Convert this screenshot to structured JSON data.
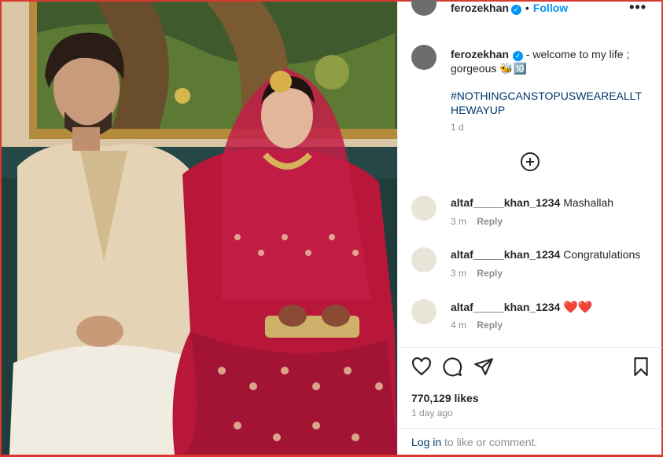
{
  "post": {
    "author": "ferozekhan",
    "verified_mark": "✓",
    "separator": "•",
    "follow_label": "Follow",
    "more_label": "•••",
    "caption_text": "- welcome to my life ; gorgeous 🐝🔟",
    "hashtag": "#NOTHINGCANSTOPUSWEAREALLTHEWAYUP",
    "caption_time": "1 d",
    "load_more_icon": "plus-circle-icon"
  },
  "comments": [
    {
      "user": "altaf_____khan_1234",
      "text": "Mashallah",
      "time": "3 m",
      "reply_label": "Reply"
    },
    {
      "user": "altaf_____khan_1234",
      "text": "Congratulations",
      "time": "3 m",
      "reply_label": "Reply"
    },
    {
      "user": "altaf_____khan_1234",
      "text": "❤️❤️",
      "time": "4 m",
      "reply_label": "Reply"
    }
  ],
  "actions": {
    "like_icon": "heart-icon",
    "comment_icon": "comment-icon",
    "share_icon": "send-icon",
    "save_icon": "bookmark-icon"
  },
  "stats": {
    "likes": "770,129 likes",
    "posted_ago": "1 day ago"
  },
  "footer": {
    "login_link": "Log in",
    "login_suffix": " to like or comment."
  },
  "colors": {
    "accent_blue": "#0095f6",
    "link_blue": "#00376b",
    "heart_red": "#ed4956",
    "frame_red": "#d8382f",
    "muted_gray": "#8e8e8e"
  }
}
